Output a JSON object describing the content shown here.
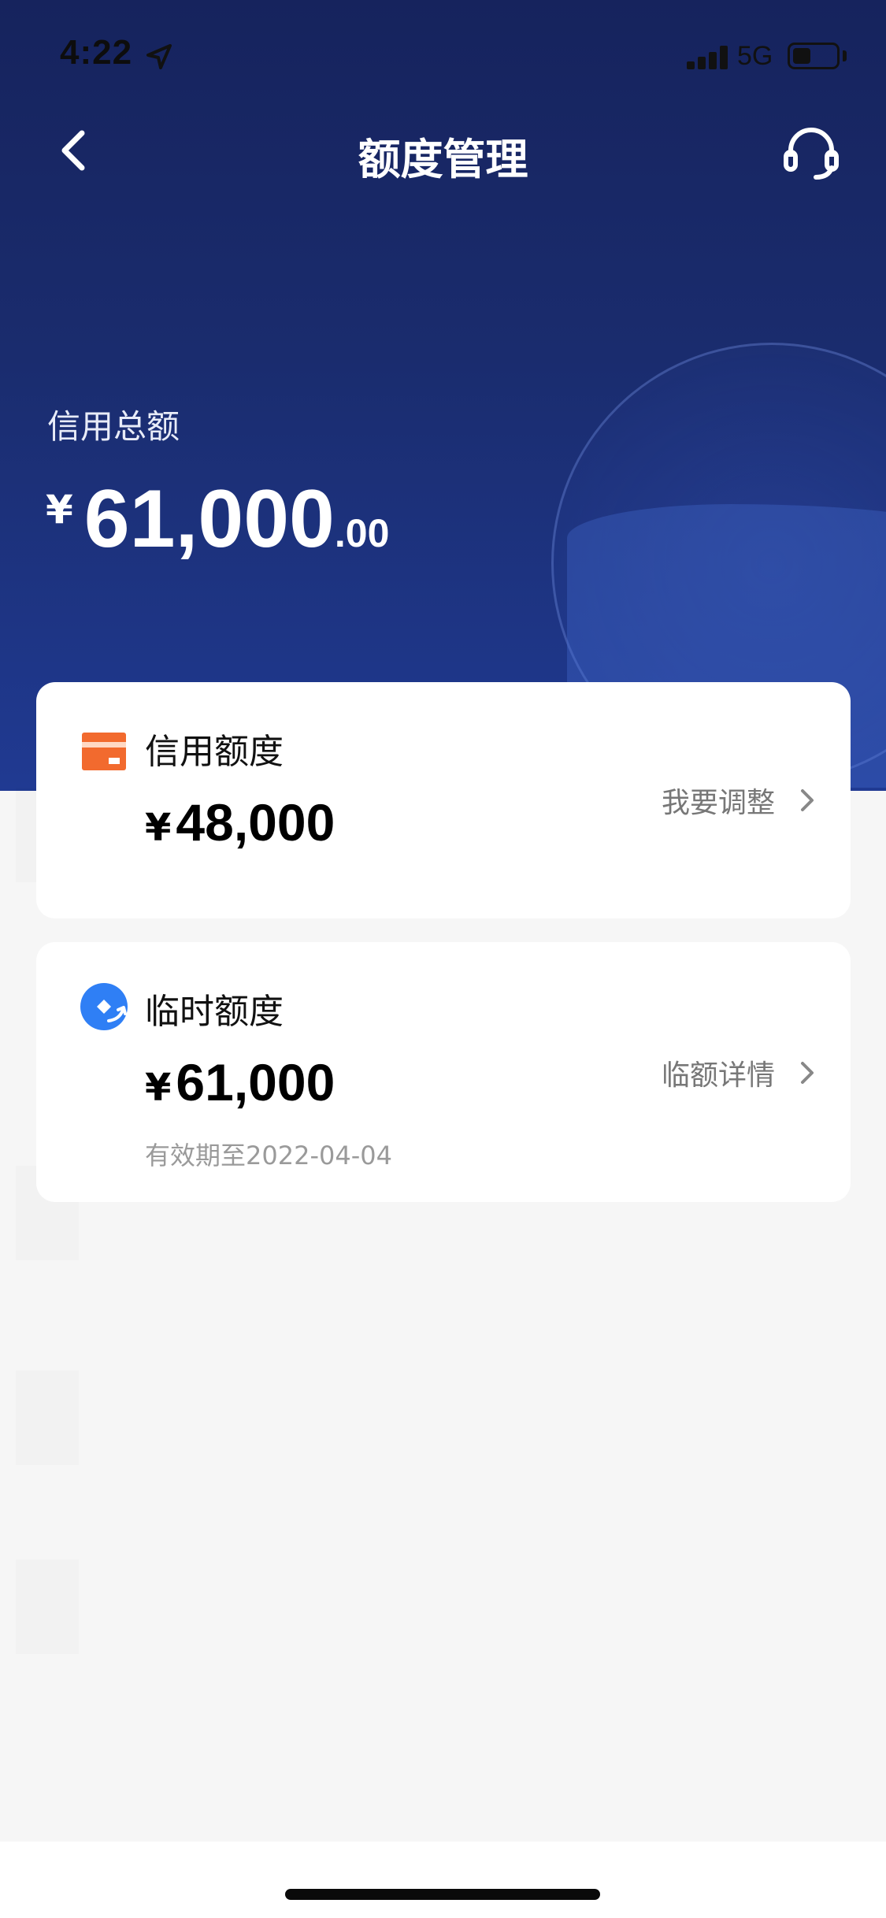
{
  "status_bar": {
    "time": "4:22",
    "network": "5G"
  },
  "nav": {
    "title": "额度管理",
    "back_icon": "chevron-left-icon",
    "support_icon": "headset-icon"
  },
  "summary": {
    "label": "信用总额",
    "currency": "¥",
    "amount_int": "61,000",
    "amount_dec": ".00"
  },
  "cards": [
    {
      "title": "信用额度",
      "icon": "credit-card-icon",
      "icon_color": "#f26a2e",
      "currency": "¥",
      "amount": "48,000",
      "link_label": "我要调整"
    },
    {
      "title": "临时额度",
      "icon": "temporary-limit-icon",
      "icon_color": "#2f7ff5",
      "currency": "¥",
      "amount": "61,000",
      "sub": "有效期至2022-04-04",
      "link_label": "临额详情"
    }
  ],
  "colors": {
    "header_bg": "#1a2c6e",
    "page_bg": "#f6f6f6",
    "card_bg": "#ffffff"
  }
}
